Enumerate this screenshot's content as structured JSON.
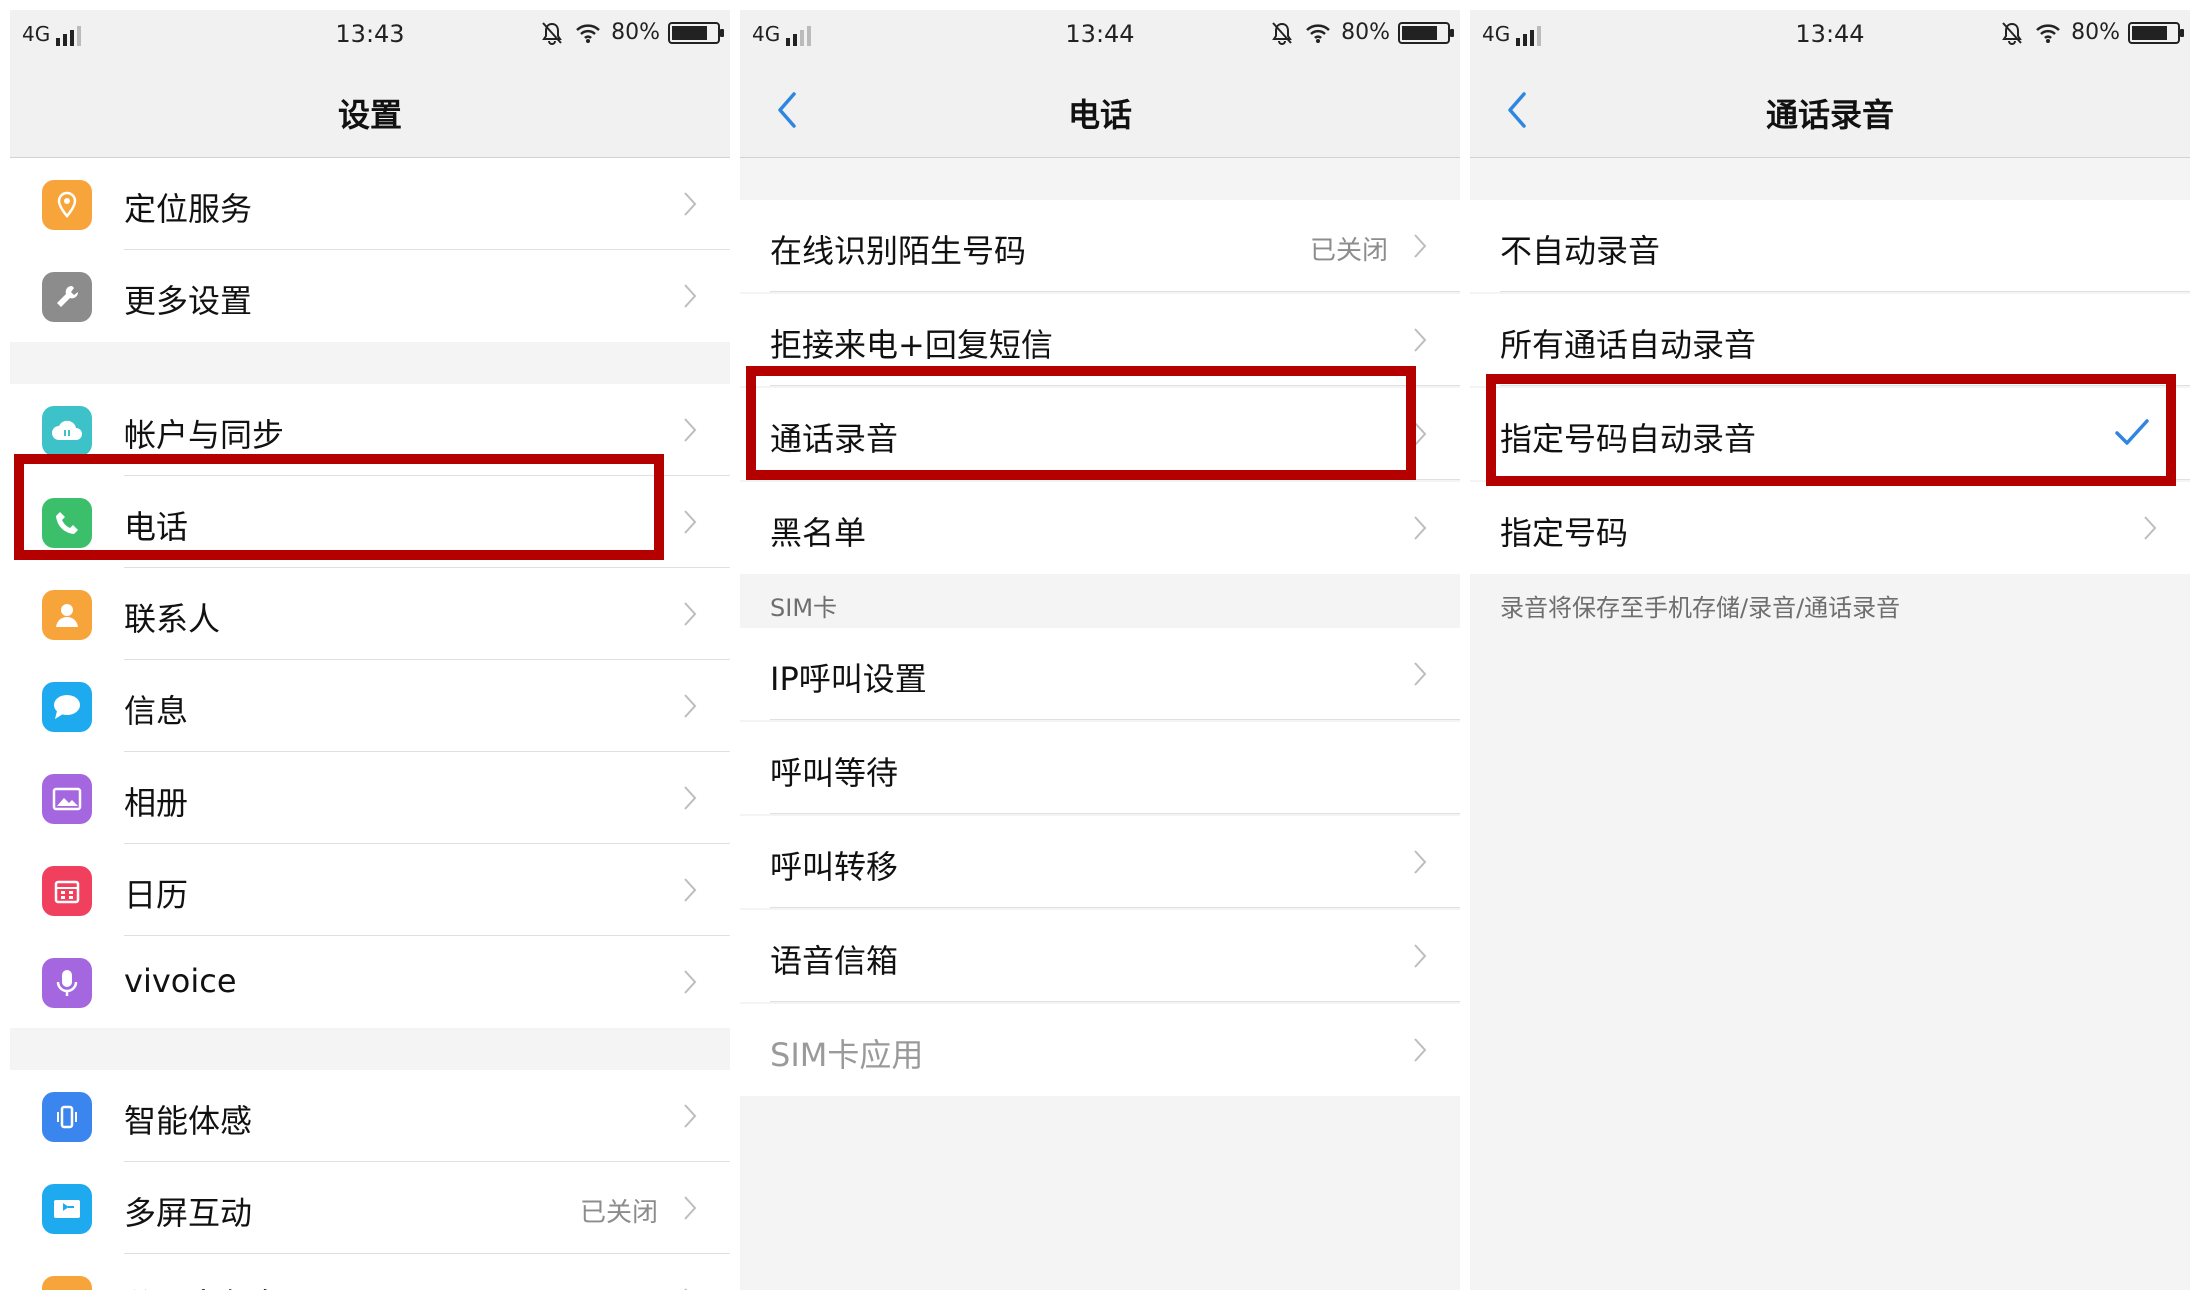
{
  "colors": {
    "highlight": "#b50000",
    "accent": "#2f86e0",
    "bg": "#f4f4f4"
  },
  "panel1": {
    "status": {
      "network": "4G",
      "time": "13:43",
      "battery": "80%"
    },
    "title": "设置",
    "items": [
      {
        "label": "定位服务",
        "icon": "location-pin-icon",
        "color": "#f7a43a"
      },
      {
        "label": "更多设置",
        "icon": "wrench-icon",
        "color": "#8c8c8c"
      },
      {
        "label": "帐户与同步",
        "icon": "cloud-sync-icon",
        "color": "#3cc2c8"
      },
      {
        "label": "电话",
        "icon": "phone-icon",
        "color": "#3bbf6a"
      },
      {
        "label": "联系人",
        "icon": "contact-icon",
        "color": "#f7a43a"
      },
      {
        "label": "信息",
        "icon": "message-bubble-icon",
        "color": "#1eaaee"
      },
      {
        "label": "相册",
        "icon": "gallery-icon",
        "color": "#a467e0"
      },
      {
        "label": "日历",
        "icon": "calendar-icon",
        "color": "#f0405e"
      },
      {
        "label": "vivoice",
        "icon": "microphone-icon",
        "color": "#a467e0"
      },
      {
        "label": "智能体感",
        "icon": "smart-motion-icon",
        "color": "#3b86ee"
      },
      {
        "label": "多屏互动",
        "icon": "multi-screen-icon",
        "color": "#1eaaee",
        "value": "已关闭"
      },
      {
        "label": "分屏多任务",
        "icon": "split-screen-icon",
        "color": "#f7a43a"
      }
    ]
  },
  "panel2": {
    "status": {
      "network": "4G",
      "time": "13:44",
      "battery": "80%"
    },
    "title": "电话",
    "items": [
      {
        "label": "在线识别陌生号码",
        "value": "已关闭"
      },
      {
        "label": "拒接来电+回复短信"
      },
      {
        "label": "通话录音"
      },
      {
        "label": "黑名单"
      }
    ],
    "section": "SIM卡",
    "sim_items": [
      {
        "label": "IP呼叫设置"
      },
      {
        "label": "呼叫等待"
      },
      {
        "label": "呼叫转移"
      },
      {
        "label": "语音信箱"
      },
      {
        "label": "SIM卡应用"
      }
    ]
  },
  "panel3": {
    "status": {
      "network": "4G",
      "time": "13:44",
      "battery": "80%"
    },
    "title": "通话录音",
    "options": [
      {
        "label": "不自动录音"
      },
      {
        "label": "所有通话自动录音"
      },
      {
        "label": "指定号码自动录音",
        "selected": true
      },
      {
        "label": "指定号码"
      }
    ],
    "note": "录音将保存至手机存储/录音/通话录音"
  }
}
